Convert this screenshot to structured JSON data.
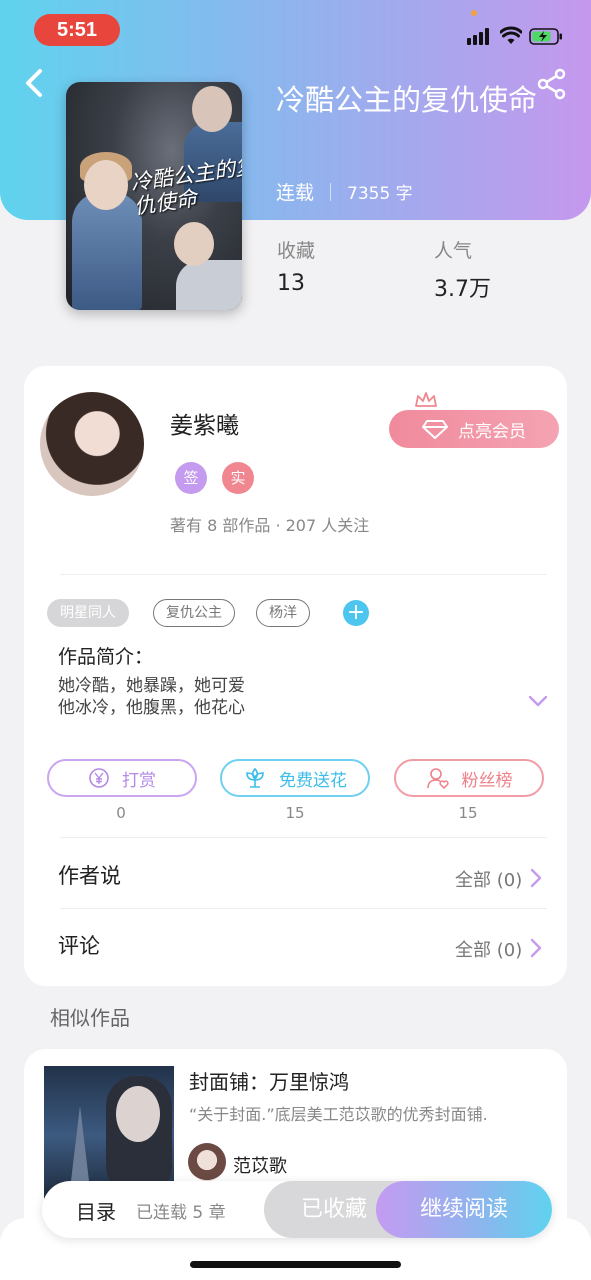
{
  "status_bar": {
    "time": "5:51"
  },
  "book": {
    "title": "冷酷公主的复仇使命",
    "cover_title": "冷酷公主的复仇使命",
    "status": "连载",
    "words": "7355 字",
    "stats": [
      {
        "label": "收藏",
        "value": "13"
      },
      {
        "label": "人气",
        "value": "3.7万"
      }
    ]
  },
  "author": {
    "name": "姜紫曦",
    "badges": [
      "签",
      "实"
    ],
    "summary": "著有 8 部作品 · 207 人关注",
    "vip_label": "点亮会员"
  },
  "tags": [
    "明星同人",
    "复仇公主",
    "杨洋"
  ],
  "tag_add": "+",
  "intro": {
    "label": "作品简介：",
    "line1": "她冷酷，她暴躁，她可爱",
    "line2": "他冰冷，他腹黑，他花心"
  },
  "actions": [
    {
      "label": "打赏",
      "count": "0",
      "color": "#c49bee"
    },
    {
      "label": "免费送花",
      "count": "15",
      "color": "#4cc6ee"
    },
    {
      "label": "粉丝榜",
      "count": "15",
      "color": "#f0868f"
    }
  ],
  "sections": [
    {
      "label": "作者说",
      "right": "全部 (0)"
    },
    {
      "label": "评论",
      "right": "全部 (0)"
    }
  ],
  "similar": {
    "title": "相似作品",
    "item": {
      "title": "封面铺：万里惊鸿",
      "desc": "“关于封面.”底层美工范苡歌的优秀封面铺.",
      "author": "范苡歌"
    }
  },
  "bottom_bar": {
    "toc_label": "目录",
    "toc_status": "已连载 5 章",
    "collected_label": "已收藏",
    "read_label": "继续阅读"
  },
  "colors": {
    "accent_purple": "#c49bee",
    "accent_cyan": "#4cc6ee",
    "accent_pink": "#f0868f",
    "status_red": "#e8453c"
  }
}
